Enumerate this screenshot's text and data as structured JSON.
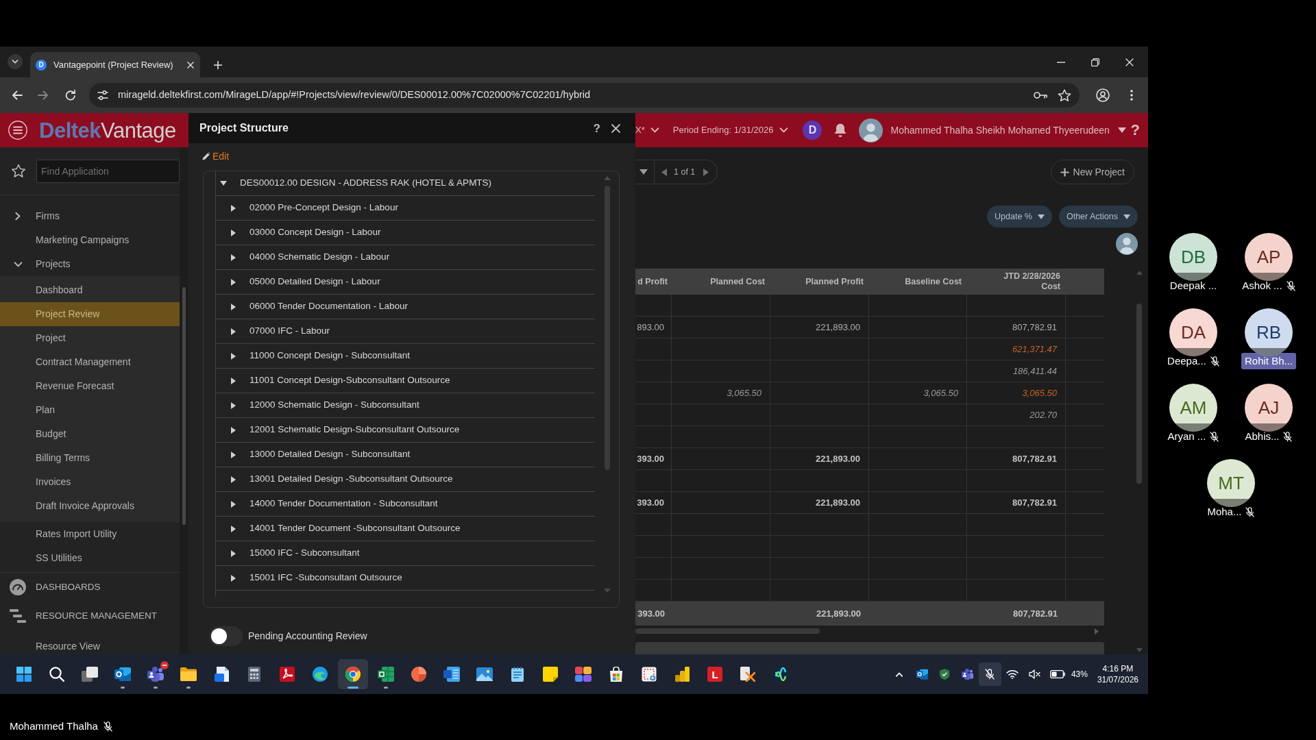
{
  "browser": {
    "tab": {
      "favicon": "D",
      "title": "Vantagepoint (Project Review)"
    },
    "url": "mirageld.deltekfirst.com/MirageLD/app/#!Projects/view/review/0/DES00012.00%7C02000%7C02201/hybrid"
  },
  "app_header": {
    "brand": "Deltek",
    "product": "Vantage",
    "company": "X*",
    "period": "Period Ending: 1/31/2026",
    "assistant": "D",
    "user": "Mohammed Thalha Sheikh Mohamed Thyeerudeen",
    "help": "?"
  },
  "sidebar": {
    "search": {
      "placeholder": "Find Application"
    },
    "items": [
      {
        "kind": "group",
        "label": "Firms",
        "expanded": false,
        "selected": false
      },
      {
        "kind": "link",
        "label": "Marketing Campaigns",
        "selected": false
      },
      {
        "kind": "group",
        "label": "Projects",
        "expanded": true,
        "selected": false,
        "children": [
          {
            "label": "Dashboard",
            "selected": false
          },
          {
            "label": "Project Review",
            "selected": true
          },
          {
            "label": "Project",
            "selected": false
          },
          {
            "label": "Contract Management",
            "selected": false
          },
          {
            "label": "Revenue Forecast",
            "selected": false
          },
          {
            "label": "Plan",
            "selected": false
          },
          {
            "label": "Budget",
            "selected": false
          },
          {
            "label": "Billing Terms",
            "selected": false
          },
          {
            "label": "Invoices",
            "selected": false
          },
          {
            "label": "Draft Invoice Approvals",
            "selected": false
          }
        ]
      },
      {
        "kind": "link",
        "label": "Rates Import Utility",
        "selected": false
      },
      {
        "kind": "link",
        "label": "SS Utilities",
        "selected": false
      }
    ],
    "sections": [
      {
        "kind": "dashboards",
        "label": "DASHBOARDS"
      },
      {
        "kind": "resources",
        "label": "RESOURCE MANAGEMENT",
        "children": [
          {
            "label": "Resource View",
            "selected": false
          }
        ]
      }
    ]
  },
  "dialog": {
    "title": "Project Structure",
    "help": "?",
    "edit": "Edit",
    "tree": {
      "label": "DES00012.00 DESIGN - ADDRESS RAK (HOTEL & APMTS)",
      "expanded": true,
      "children": [
        {
          "label": "02000 Pre-Concept Design - Labour",
          "expanded": false
        },
        {
          "label": "03000 Concept Design - Labour",
          "expanded": false
        },
        {
          "label": "04000 Schematic Design - Labour",
          "expanded": false
        },
        {
          "label": "05000 Detailed Design - Labour",
          "expanded": false
        },
        {
          "label": "06000 Tender Documentation - Labour",
          "expanded": false
        },
        {
          "label": "07000 IFC - Labour",
          "expanded": false
        },
        {
          "label": "11000 Concept Design - Subconsultant",
          "expanded": false
        },
        {
          "label": "11001 Concept Design-Subconsultant Outsource",
          "expanded": false
        },
        {
          "label": "12000 Schematic Design - Subconsultant",
          "expanded": false
        },
        {
          "label": "12001 Schematic Design-Subconsultant Outsource",
          "expanded": false
        },
        {
          "label": "13000 Detailed Design - Subconsultant",
          "expanded": false
        },
        {
          "label": "13001 Detailed Design -Subconsultant Outsource",
          "expanded": false
        },
        {
          "label": "14000 Tender Documentation - Subconsultant",
          "expanded": false
        },
        {
          "label": "14001 Tender Document -Subconsultant Outsource",
          "expanded": false
        },
        {
          "label": "15000 IFC - Subconsultant",
          "expanded": false
        },
        {
          "label": "15001 IFC -Subconsultant Outsource",
          "expanded": false
        }
      ]
    },
    "toggle": {
      "label": "Pending Accounting Review",
      "on": false
    }
  },
  "main": {
    "pager": "1 of 1",
    "new_project": "New Project",
    "actions": [
      "Update %",
      "Other Actions"
    ],
    "table": {
      "columns": [
        "d Profit",
        "Planned Cost",
        "Planned Profit",
        "Baseline Cost",
        "JTD 2/28/2026 Cost"
      ],
      "rows": [
        {
          "kind": "detail"
        },
        {
          "kind": "detail",
          "column_1": {
            "text": "893.00",
            "kind": "actual"
          },
          "planned_profit": {
            "text": "221,893.00",
            "kind": "actual"
          },
          "jtd_cost": {
            "text": "807,782.91",
            "kind": "actual"
          }
        },
        {
          "kind": "detail",
          "jtd_cost": {
            "text": "621,371.47",
            "kind": "flagged"
          }
        },
        {
          "kind": "detail",
          "jtd_cost": {
            "text": "186,411.44",
            "kind": "projected"
          }
        },
        {
          "kind": "detail",
          "planned_cost": {
            "text": "3,065.50",
            "kind": "projected"
          },
          "baseline_cost": {
            "text": "3,065.50",
            "kind": "projected"
          },
          "jtd_cost": {
            "text": "3,065.50",
            "kind": "flagged"
          }
        },
        {
          "kind": "detail",
          "jtd_cost": {
            "text": "202.70",
            "kind": "projected"
          }
        },
        {
          "kind": "detail"
        },
        {
          "kind": "subtotal",
          "column_1": {
            "text": "393.00",
            "kind": "actual"
          },
          "planned_profit": {
            "text": "221,893.00",
            "kind": "actual"
          },
          "jtd_cost": {
            "text": "807,782.91",
            "kind": "actual"
          }
        },
        {
          "kind": "detail"
        },
        {
          "kind": "subtotal",
          "column_1": {
            "text": "393.00",
            "kind": "actual"
          },
          "planned_profit": {
            "text": "221,893.00",
            "kind": "actual"
          },
          "jtd_cost": {
            "text": "807,782.91",
            "kind": "actual"
          }
        },
        {
          "kind": "detail"
        },
        {
          "kind": "detail"
        },
        {
          "kind": "detail"
        },
        {
          "kind": "detail"
        }
      ],
      "totals": {
        "column_1": "393.00",
        "planned_profit": "221,893.00",
        "jtd_cost": "807,782.91"
      }
    }
  },
  "taskbar": {
    "apps": [
      {
        "kind": "start",
        "running": false,
        "selected": false,
        "busy": false
      },
      {
        "kind": "search",
        "running": false,
        "selected": false,
        "busy": false
      },
      {
        "kind": "task_view",
        "running": false,
        "selected": false,
        "busy": false
      },
      {
        "kind": "mail",
        "running": true,
        "selected": false,
        "busy": false
      },
      {
        "kind": "chat",
        "running": true,
        "selected": false,
        "busy": true
      },
      {
        "kind": "folder",
        "running": true,
        "selected": false,
        "busy": false
      },
      {
        "kind": "document",
        "running": false,
        "selected": false,
        "busy": false
      },
      {
        "kind": "calculator",
        "running": false,
        "selected": false,
        "busy": false
      },
      {
        "kind": "pdf",
        "running": false,
        "selected": false,
        "busy": false
      },
      {
        "kind": "wave",
        "running": false,
        "selected": false,
        "busy": false
      },
      {
        "kind": "browser",
        "running": true,
        "selected": true,
        "busy": false
      },
      {
        "kind": "spreadsheet",
        "running": true,
        "selected": false,
        "busy": false
      },
      {
        "kind": "slides",
        "running": false,
        "selected": false,
        "busy": false
      },
      {
        "kind": "text_doc",
        "running": false,
        "selected": false,
        "busy": false
      },
      {
        "kind": "photos",
        "running": false,
        "selected": false,
        "busy": false
      },
      {
        "kind": "notepad",
        "running": false,
        "selected": false,
        "busy": false
      },
      {
        "kind": "sticky",
        "running": false,
        "selected": false,
        "busy": false
      },
      {
        "kind": "suite",
        "running": false,
        "selected": false,
        "busy": false
      },
      {
        "kind": "store",
        "running": false,
        "selected": false,
        "busy": false
      },
      {
        "kind": "snip",
        "running": false,
        "selected": false,
        "busy": false
      },
      {
        "kind": "chart",
        "running": false,
        "selected": false,
        "busy": false
      },
      {
        "kind": "letter",
        "label": "L",
        "running": false,
        "selected": false,
        "busy": false
      },
      {
        "kind": "cross",
        "running": false,
        "selected": false,
        "busy": false
      },
      {
        "kind": "rings",
        "running": false,
        "selected": false,
        "busy": false
      }
    ],
    "tray": [
      {
        "kind": "overflow",
        "selected": false
      },
      {
        "kind": "mail",
        "selected": false
      },
      {
        "kind": "shield",
        "selected": false
      },
      {
        "kind": "chat",
        "selected": false
      },
      {
        "kind": "mic_off",
        "selected": true
      },
      {
        "kind": "wifi",
        "selected": false
      },
      {
        "kind": "volume_off",
        "selected": false
      },
      {
        "kind": "battery",
        "selected": false
      }
    ],
    "battery": "43%",
    "time": "4:16 PM",
    "date": "31/07/2026"
  },
  "presenter": {
    "name": "Mohammed Thalha",
    "muted": true
  },
  "participants": [
    {
      "initials": "DB",
      "name": "Deepak ...",
      "color": "#cde3d6",
      "muted": false,
      "speaking": false
    },
    {
      "initials": "AP",
      "name": "Ashok ...",
      "color": "#f5d3cd",
      "muted": true,
      "speaking": false
    },
    {
      "initials": "DA",
      "name": "Deepa...",
      "color": "#f8d8d2",
      "muted": true,
      "speaking": false
    },
    {
      "initials": "RB",
      "name": "Rohit Bh...",
      "color": "#cfdcef",
      "muted": false,
      "speaking": true
    },
    {
      "initials": "AM",
      "name": "Aryan ...",
      "color": "#dde8d3",
      "muted": true,
      "speaking": false
    },
    {
      "initials": "AJ",
      "name": "Abhis...",
      "color": "#f5d3cd",
      "muted": true,
      "speaking": false
    },
    {
      "initials": "MT",
      "name": "Moha...",
      "color": "#dde8d3",
      "muted": true,
      "speaking": false
    }
  ]
}
